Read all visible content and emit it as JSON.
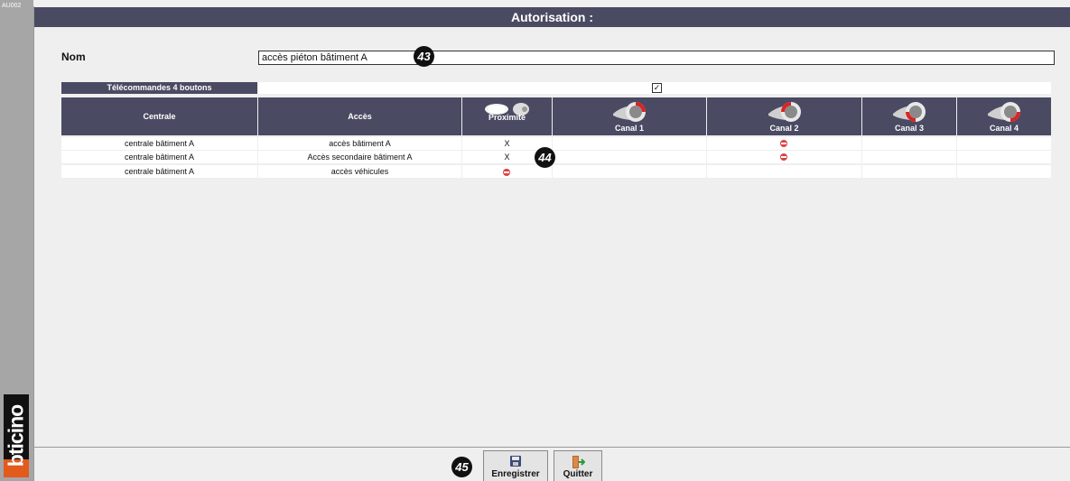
{
  "screen_code": "AU002",
  "logo_text": "bticino",
  "window": {
    "title": "Autorisation :"
  },
  "form": {
    "nom_label": "Nom",
    "nom_value": "accès piéton bâtiment A",
    "telecommande_label": "Télécommandes 4 boutons",
    "telecommande_checked": true,
    "check_glyph": "✓"
  },
  "table": {
    "headers": {
      "centrale": "Centrale",
      "acces": "Accès",
      "proximite": "Proximité",
      "canal1": "Canal 1",
      "canal2": "Canal 2",
      "canal3": "Canal 3",
      "canal4": "Canal 4"
    },
    "rows": [
      {
        "centrale": "centrale bâtiment A",
        "acces": "accès bâtiment A",
        "proximite": "X",
        "proximite_deny": false,
        "canal1": "",
        "canal2_deny": true,
        "canal3": "",
        "canal4": ""
      },
      {
        "centrale": "centrale bâtiment A",
        "acces": "Accès secondaire bâtiment A",
        "proximite": "X",
        "proximite_deny": false,
        "canal1": "",
        "canal2_deny": true,
        "canal3": "",
        "canal4": ""
      },
      {
        "centrale": "centrale bâtiment A",
        "acces": "accès véhicules",
        "proximite": "",
        "proximite_deny": true,
        "canal1": "",
        "canal2_deny": false,
        "canal3": "",
        "canal4": ""
      }
    ]
  },
  "markers": {
    "m43": "43",
    "m44": "44",
    "m45": "45"
  },
  "footer": {
    "save_label": "Enregistrer",
    "quit_label": "Quitter"
  },
  "colors": {
    "header_bg": "#4a4a63",
    "deny_red": "#e04040",
    "logo_orange": "#e25a1c"
  },
  "icons": {
    "deny": "no-entry-icon",
    "save": "floppy-disk-icon",
    "quit": "exit-door-icon",
    "proximity": "badge-and-fob-icon",
    "remote": "four-button-remote-icon"
  }
}
